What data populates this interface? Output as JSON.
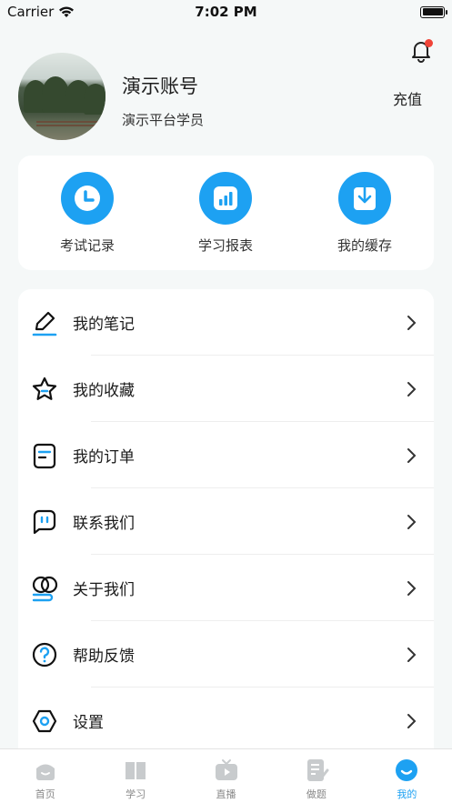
{
  "status_bar": {
    "carrier": "Carrier",
    "time": "7:02 PM"
  },
  "profile": {
    "name": "演示账号",
    "role": "演示平台学员",
    "recharge_label": "充值"
  },
  "quick_actions": [
    {
      "label": "考试记录",
      "icon": "clock-icon"
    },
    {
      "label": "学习报表",
      "icon": "bar-chart-icon"
    },
    {
      "label": "我的缓存",
      "icon": "download-icon"
    }
  ],
  "menu": [
    {
      "label": "我的笔记",
      "icon": "pencil-icon"
    },
    {
      "label": "我的收藏",
      "icon": "star-icon"
    },
    {
      "label": "我的订单",
      "icon": "order-icon"
    },
    {
      "label": "联系我们",
      "icon": "chat-icon"
    },
    {
      "label": "关于我们",
      "icon": "about-icon"
    },
    {
      "label": "帮助反馈",
      "icon": "help-icon"
    },
    {
      "label": "设置",
      "icon": "settings-icon"
    }
  ],
  "tabbar": [
    {
      "label": "首页",
      "icon": "home-icon"
    },
    {
      "label": "学习",
      "icon": "book-icon"
    },
    {
      "label": "直播",
      "icon": "tv-icon"
    },
    {
      "label": "做题",
      "icon": "exercise-icon"
    },
    {
      "label": "我的",
      "icon": "profile-icon"
    }
  ],
  "colors": {
    "accent": "#1da1f2",
    "badge": "#f04438",
    "background": "#f5f8f8"
  }
}
